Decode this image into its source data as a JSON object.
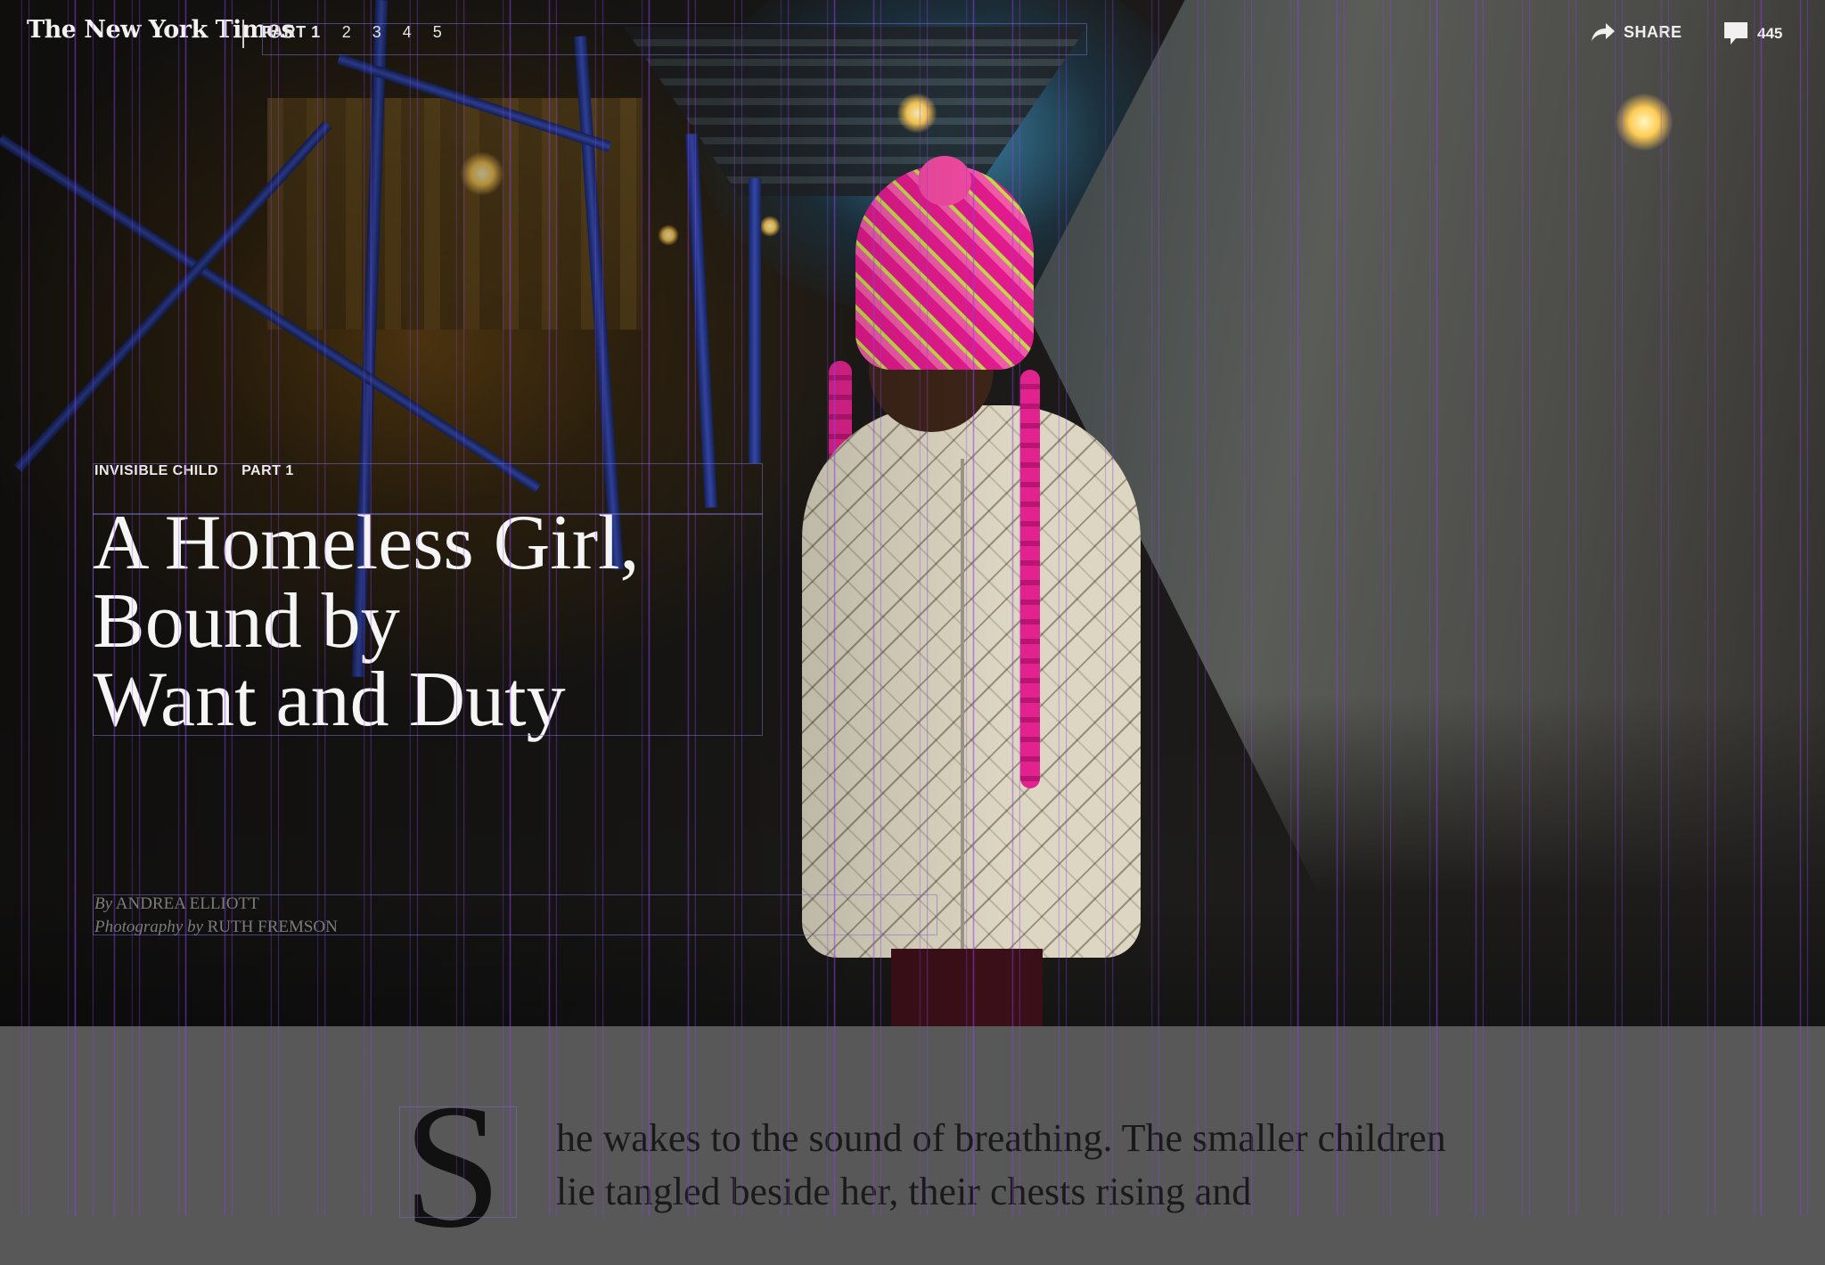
{
  "header": {
    "logo": "The New York Times",
    "parts": {
      "current": "PART 1",
      "others": [
        "2",
        "3",
        "4",
        "5"
      ]
    },
    "share_label": "SHARE",
    "comments_count": "445"
  },
  "hero": {
    "kicker_series": "INVISIBLE CHILD",
    "kicker_part": "PART 1",
    "headline_lines": [
      "A Homeless Girl,",
      "Bound by",
      "Want and Duty"
    ],
    "byline_author_prefix": "By",
    "byline_author": "ANDREA ELLIOTT",
    "byline_photo_prefix": "Photography by",
    "byline_photographer": "RUTH FREMSON"
  },
  "article": {
    "dropcap": "S",
    "lead_text": "he wakes to the sound of breathing. The smaller children lie tangled beside her, their chests rising and"
  },
  "icons": {
    "share": "share-arrow-icon",
    "comments": "speech-bubble-icon"
  },
  "colors": {
    "accent_hat": "#e21b8c",
    "scaffold_blue": "#3f55c9",
    "page_background": "#585858"
  }
}
